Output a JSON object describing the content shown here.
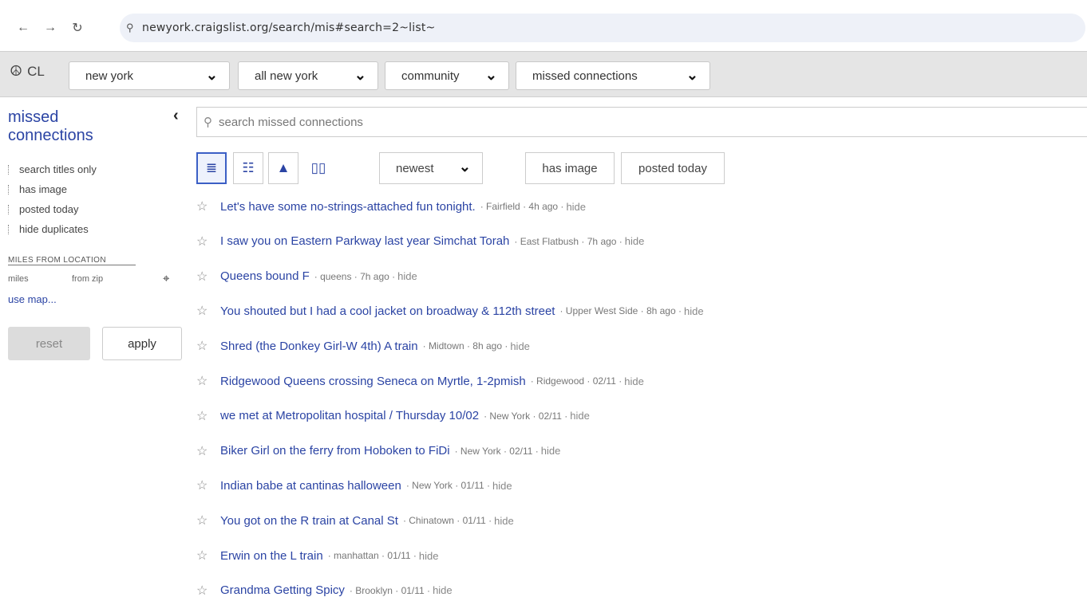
{
  "browser": {
    "back_icon": "←",
    "forward_icon": "→",
    "reload_icon": "↻",
    "site_icon": "⚲",
    "url": "newyork.craigslist.org/search/mis#search=2~list~"
  },
  "header": {
    "logo_icon": "☮",
    "logo_text": "CL",
    "area": "new york",
    "subarea": "all new york",
    "category": "community",
    "subcategory": "missed connections"
  },
  "sidebar": {
    "title": "missed connections",
    "collapse_icon": "‹",
    "options": [
      "search titles only",
      "has image",
      "posted today",
      "hide duplicates"
    ],
    "miles_heading": "MILES FROM LOCATION",
    "miles_placeholder": "miles",
    "from_zip_placeholder": "from zip",
    "use_map": "use map...",
    "reset": "reset",
    "apply": "apply"
  },
  "main": {
    "search_placeholder": "search missed connections",
    "view_icons": [
      "≣",
      "☷",
      "▲",
      "▯▯"
    ],
    "sort": "newest",
    "has_image": "has image",
    "posted_today": "posted today",
    "hide_label": "hide",
    "results": [
      {
        "title": "Let's have some no-strings-attached fun tonight.",
        "meta": "· Fairfield · 4h ago ·"
      },
      {
        "title": "I saw you on Eastern Parkway last year Simchat Torah",
        "meta": "· East Flatbush · 7h ago ·"
      },
      {
        "title": "Queens bound F",
        "meta": "· queens · 7h ago ·"
      },
      {
        "title": "You shouted but I had a cool jacket on broadway & 112th street",
        "meta": "· Upper West Side · 8h ago ·"
      },
      {
        "title": "Shred (the Donkey Girl-W 4th) A train",
        "meta": "· Midtown · 8h ago ·"
      },
      {
        "title": "Ridgewood Queens crossing Seneca on Myrtle, 1-2pmish",
        "meta": "· Ridgewood · 02/11 ·"
      },
      {
        "title": "we met at Metropolitan hospital / Thursday 10/02",
        "meta": "· New York · 02/11 ·"
      },
      {
        "title": "Biker Girl on the ferry from Hoboken to FiDi",
        "meta": "· New York · 02/11 ·"
      },
      {
        "title": "Indian babe at cantinas halloween",
        "meta": "· New York · 01/11 ·"
      },
      {
        "title": "You got on the R train at Canal St",
        "meta": "· Chinatown · 01/11 ·"
      },
      {
        "title": "Erwin on the L train",
        "meta": "· manhattan · 01/11 ·"
      },
      {
        "title": "Grandma Getting Spicy",
        "meta": "· Brooklyn · 01/11 ·"
      }
    ]
  }
}
